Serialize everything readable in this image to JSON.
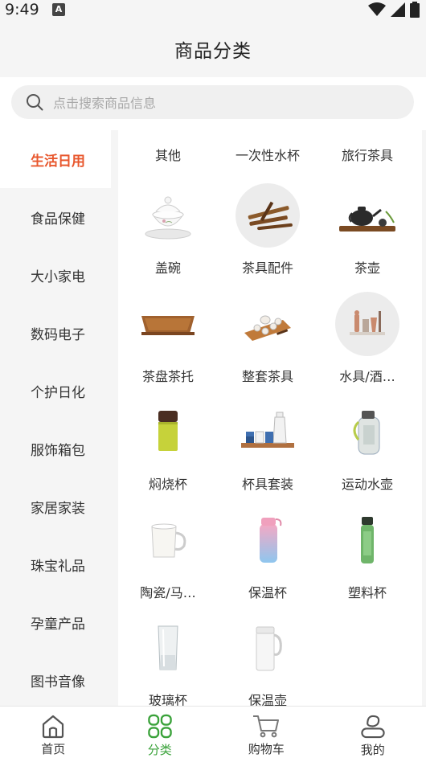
{
  "status_bar": {
    "time": "9:49",
    "badge": "A"
  },
  "header": {
    "title": "商品分类"
  },
  "search": {
    "placeholder": "点击搜索商品信息",
    "icon": "search-icon"
  },
  "sidebar": {
    "active_index": 0,
    "items": [
      {
        "label": "生活日用"
      },
      {
        "label": "食品保健"
      },
      {
        "label": "大小家电"
      },
      {
        "label": "数码电子"
      },
      {
        "label": "个护日化"
      },
      {
        "label": "服饰箱包"
      },
      {
        "label": "家居家装"
      },
      {
        "label": "珠宝礼品"
      },
      {
        "label": "孕童产品"
      },
      {
        "label": "图书音像"
      }
    ]
  },
  "content": {
    "top_categories": [
      {
        "label": "其他"
      },
      {
        "label": "一次性水杯"
      },
      {
        "label": "旅行茶具"
      }
    ],
    "items": [
      {
        "label": "盖碗",
        "icon": "gaiwan-image"
      },
      {
        "label": "茶具配件",
        "icon": "tea-tools-image"
      },
      {
        "label": "茶壶",
        "icon": "teapot-image"
      },
      {
        "label": "茶盘茶托",
        "icon": "tea-tray-image"
      },
      {
        "label": "整套茶具",
        "icon": "tea-set-image"
      },
      {
        "label": "水具/酒…",
        "icon": "bar-tools-image"
      },
      {
        "label": "焖烧杯",
        "icon": "thermal-cup-image"
      },
      {
        "label": "杯具套装",
        "icon": "cup-set-image"
      },
      {
        "label": "运动水壶",
        "icon": "sport-bottle-image"
      },
      {
        "label": "陶瓷/马…",
        "icon": "mug-image"
      },
      {
        "label": "保温杯",
        "icon": "vacuum-bottle-image"
      },
      {
        "label": "塑料杯",
        "icon": "plastic-bottle-image"
      },
      {
        "label": "玻璃杯",
        "icon": "glass-image"
      },
      {
        "label": "保温壶",
        "icon": "thermos-jug-image"
      }
    ]
  },
  "tabbar": {
    "active_index": 1,
    "accent": "#3aa23a",
    "tabs": [
      {
        "label": "首页",
        "icon": "home-icon"
      },
      {
        "label": "分类",
        "icon": "category-icon"
      },
      {
        "label": "购物车",
        "icon": "cart-icon"
      },
      {
        "label": "我的",
        "icon": "profile-icon"
      }
    ]
  }
}
